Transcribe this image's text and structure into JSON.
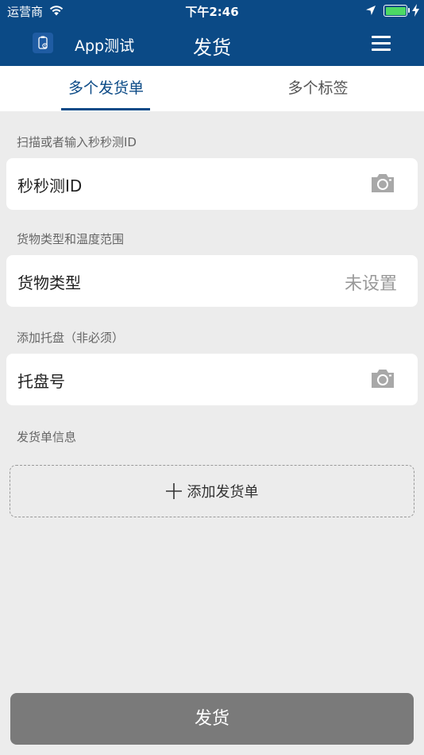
{
  "status_bar": {
    "carrier": "运营商",
    "time": "下午2:46"
  },
  "header": {
    "app_name": "App测试",
    "title": "发货"
  },
  "tabs": [
    {
      "label": "多个发货单",
      "active": true
    },
    {
      "label": "多个标签",
      "active": false
    }
  ],
  "sections": {
    "scan_label": "扫描或者输入秒秒测ID",
    "scan_field": "秒秒测ID",
    "goods_label": "货物类型和温度范围",
    "goods_field": "货物类型",
    "goods_value": "未设置",
    "pallet_label": "添加托盘（非必须）",
    "pallet_field": "托盘号",
    "invoice_label": "发货单信息",
    "add_invoice": "添加发货单"
  },
  "ship_button": "发货",
  "colors": {
    "primary": "#0b4a86",
    "disabled_button": "#7a7a7a",
    "battery": "#4cd964"
  },
  "icons": [
    "wifi-icon",
    "location-arrow-icon",
    "battery-icon",
    "charging-bolt-icon",
    "app-logo-icon",
    "menu-icon",
    "camera-icon",
    "plus-icon"
  ]
}
